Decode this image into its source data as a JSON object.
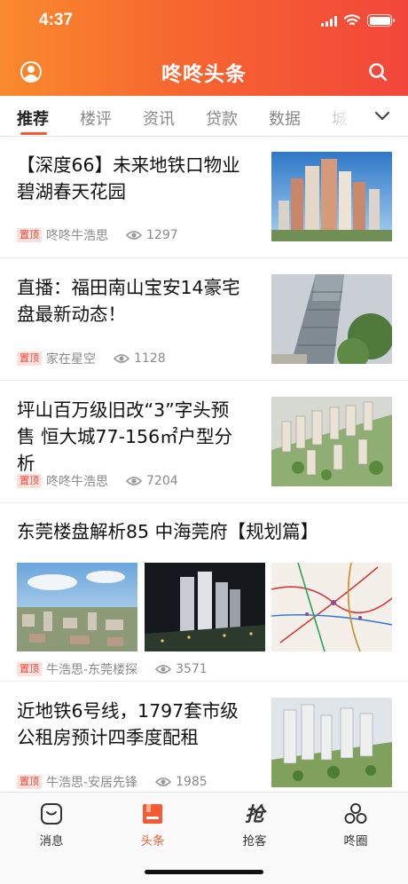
{
  "status_bar": {
    "time": "4:37"
  },
  "header": {
    "title": "咚咚头条",
    "avatar_icon": "user-icon",
    "search_icon": "search-icon"
  },
  "colors": {
    "brand_start": "#f98a2d",
    "brand_end": "#f2463b",
    "accent": "#f45a34",
    "pin_text": "#f04a3c",
    "pin_bg": "#fbe1dc"
  },
  "tabs": [
    {
      "label": "推荐",
      "active": true
    },
    {
      "label": "楼评"
    },
    {
      "label": "资讯"
    },
    {
      "label": "贷款"
    },
    {
      "label": "数据"
    },
    {
      "label": "城市"
    }
  ],
  "tabs_more_icon": "chevron-down-icon",
  "articles": [
    {
      "title_lines": [
        "【深度66】未来地铁口物业",
        "碧湖春天花园"
      ],
      "pin": "置顶",
      "author": "咚咚牛浩思",
      "views": "1297",
      "image": "high-rise residential towers under blue sky"
    },
    {
      "title_lines": [
        "直播：福田南山宝安14豪宅",
        "盘最新动态！"
      ],
      "pin": "置顶",
      "author": "家在星空",
      "views": "1128",
      "image": "tall residential tower viewed from below"
    },
    {
      "title_lines": [
        "坪山百万级旧改“3”字头预",
        "售  恒大城77-156㎡户型分",
        "析"
      ],
      "pin": "置顶",
      "author": "咚咚牛浩思",
      "views": "7204",
      "image": "aerial rendering of residential complex"
    },
    {
      "title_lines": [
        "东莞楼盘解析85 中海莞府【规划篇】"
      ],
      "pin": "置顶",
      "author": "牛浩思-东莞楼探",
      "views": "3571",
      "images": [
        "city skyline aerial photo",
        "night rendering of towers",
        "regional transit map"
      ]
    },
    {
      "title_lines": [
        "近地铁6号线，1797套市级",
        "公租房预计四季度配租"
      ],
      "pin": "置顶",
      "author": "牛浩思-安居先锋",
      "views": "1985",
      "image": "aerial rendering of public housing towers"
    }
  ],
  "tabbar": [
    {
      "label": "消息",
      "icon": "message-icon"
    },
    {
      "label": "头条",
      "icon": "headline-icon",
      "active": true
    },
    {
      "label": "抢客",
      "icon": "grab-icon"
    },
    {
      "label": "咚圈",
      "icon": "circle-icon"
    }
  ]
}
